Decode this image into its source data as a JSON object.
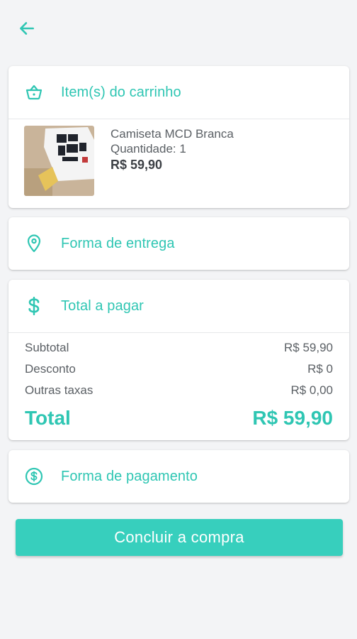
{
  "header": {
    "back_icon": "arrow-left-icon"
  },
  "cart": {
    "title": "Item(s) do carrinho",
    "icon": "basket-icon",
    "item": {
      "name": "Camiseta MCD Branca",
      "quantity": "Quantidade: 1",
      "price": "R$ 59,90"
    }
  },
  "delivery": {
    "title": "Forma de entrega",
    "icon": "location-pin-icon"
  },
  "summary": {
    "title": "Total a pagar",
    "icon": "dollar-icon",
    "subtotal_label": "Subtotal",
    "subtotal_value": "R$ 59,90",
    "discount_label": "Desconto",
    "discount_value": "R$ 0",
    "fees_label": "Outras taxas",
    "fees_value": "R$ 0,00",
    "total_label": "Total",
    "total_value": "R$ 59,90"
  },
  "payment": {
    "title": "Forma de pagamento",
    "icon": "coin-icon"
  },
  "cta": {
    "label": "Concluir a compra"
  },
  "colors": {
    "accent": "#2fc6b3",
    "button": "#37cfbd",
    "background": "#f3f4f6"
  }
}
